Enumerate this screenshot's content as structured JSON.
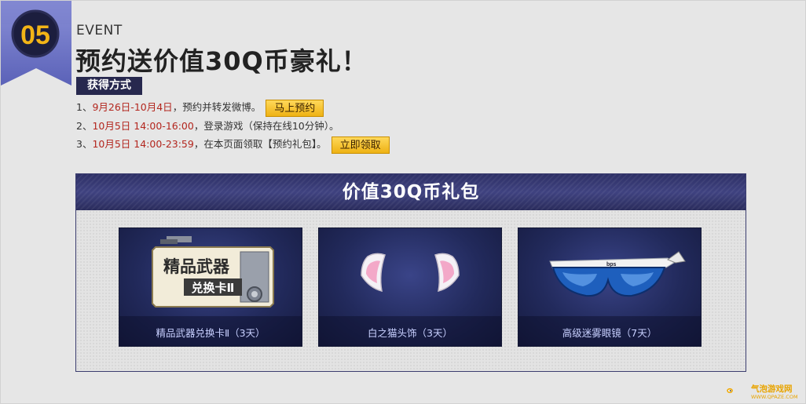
{
  "badge": {
    "number": "05"
  },
  "event": {
    "label": "EVENT",
    "title": "预约送价值30Q币豪礼！",
    "method_tag": "获得方式"
  },
  "steps": [
    {
      "prefix": "1、",
      "date": "9月26日-10月4日",
      "text": "，预约并转发微博。",
      "button": "马上预约"
    },
    {
      "prefix": "2、",
      "date": "10月5日 14:00-16:00",
      "text": "，登录游戏（保持在线10分钟）。"
    },
    {
      "prefix": "3、",
      "date": "10月5日 14:00-23:59",
      "text": "，在本页面领取【预约礼包】。",
      "button": "立即领取"
    }
  ],
  "gift": {
    "title": "价值30Q币礼包",
    "items": [
      {
        "name": "精品武器兑换卡Ⅱ（3天）",
        "art_line1": "精品武器",
        "art_line2": "兑换卡Ⅱ",
        "icon": "weapon-card-icon"
      },
      {
        "name": "白之猫头饰（3天）",
        "icon": "cat-ears-icon"
      },
      {
        "name": "高级迷雾眼镜（7天）",
        "icon": "goggles-icon"
      }
    ]
  },
  "watermark": {
    "text": "气泡游戏网",
    "sub": "WWW.QPAZE.COM"
  },
  "colors": {
    "navy": "#27284e",
    "red_text": "#b3261e",
    "gold": "#f0b820"
  }
}
